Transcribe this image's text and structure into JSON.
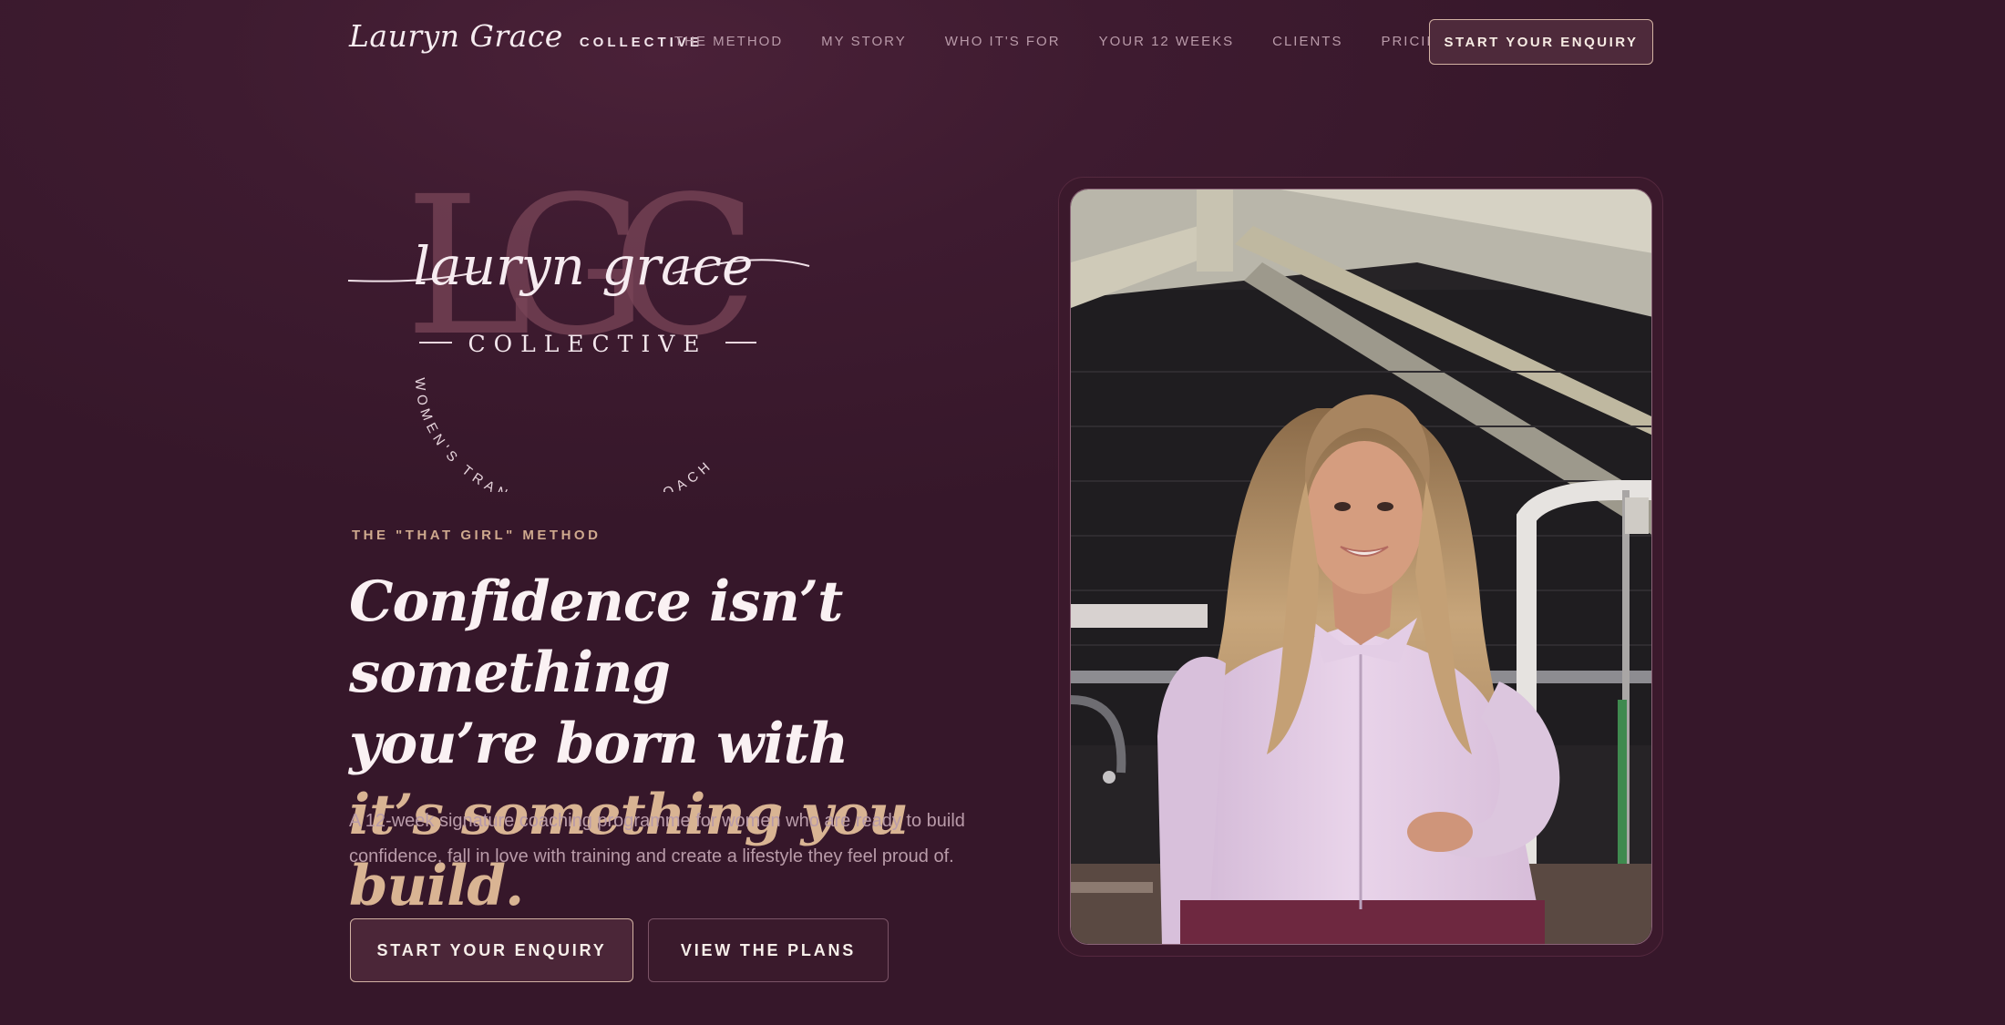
{
  "nav": {
    "brand_script": "Lauryn Grace",
    "brand_word": "COLLECTIVE",
    "links": [
      "THE METHOD",
      "MY STORY",
      "WHO IT'S FOR",
      "YOUR 12 WEEKS",
      "CLIENTS",
      "PRICING"
    ],
    "cta": "START YOUR ENQUIRY"
  },
  "emblem": {
    "monogram": "LGC",
    "script": "lauryn grace",
    "word": "COLLECTIVE",
    "arc_text": "WOMEN'S TRANSFORMATION COACH"
  },
  "hero": {
    "eyebrow": "THE \"THAT GIRL\" METHOD",
    "headline_line1": "Confidence isn’t something",
    "headline_line2": "you’re born with",
    "headline_accent": "it’s something you build.",
    "subcopy": "A 12-week signature coaching programme for women who are ready to build confidence, fall in love with training and create a lifestyle they feel proud of.",
    "primary_button": "START YOUR ENQUIRY",
    "secondary_button": "VIEW THE PLANS"
  },
  "colors": {
    "background": "#3a182c",
    "accent_gold": "#d9b493",
    "text_light": "#faf1f3",
    "muted": "#b99aa9"
  }
}
